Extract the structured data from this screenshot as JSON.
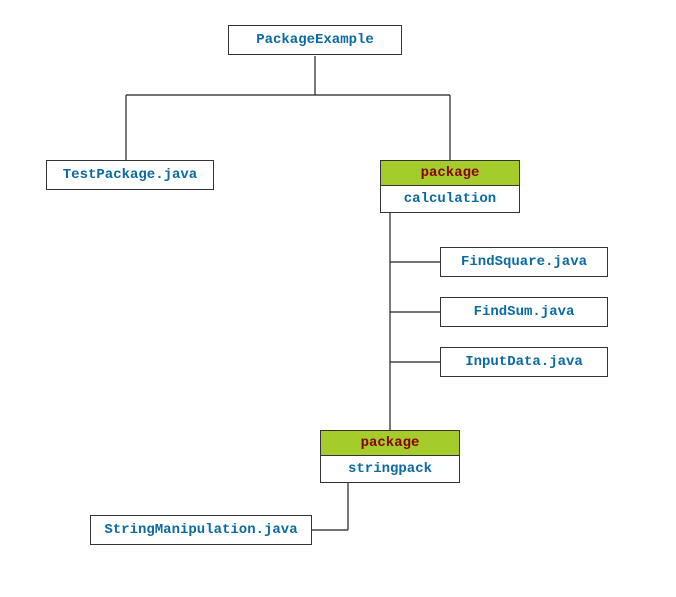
{
  "root": {
    "label": "PackageExample"
  },
  "testpackage": {
    "label": "TestPackage.java"
  },
  "pkg_calc": {
    "header": "package",
    "name": "calculation"
  },
  "files_calc": {
    "findsquare": "FindSquare.java",
    "findsum": "FindSum.java",
    "inputdata": "InputData.java"
  },
  "pkg_string": {
    "header": "package",
    "name": "stringpack"
  },
  "files_string": {
    "stringmanip": "StringManipulation.java"
  }
}
